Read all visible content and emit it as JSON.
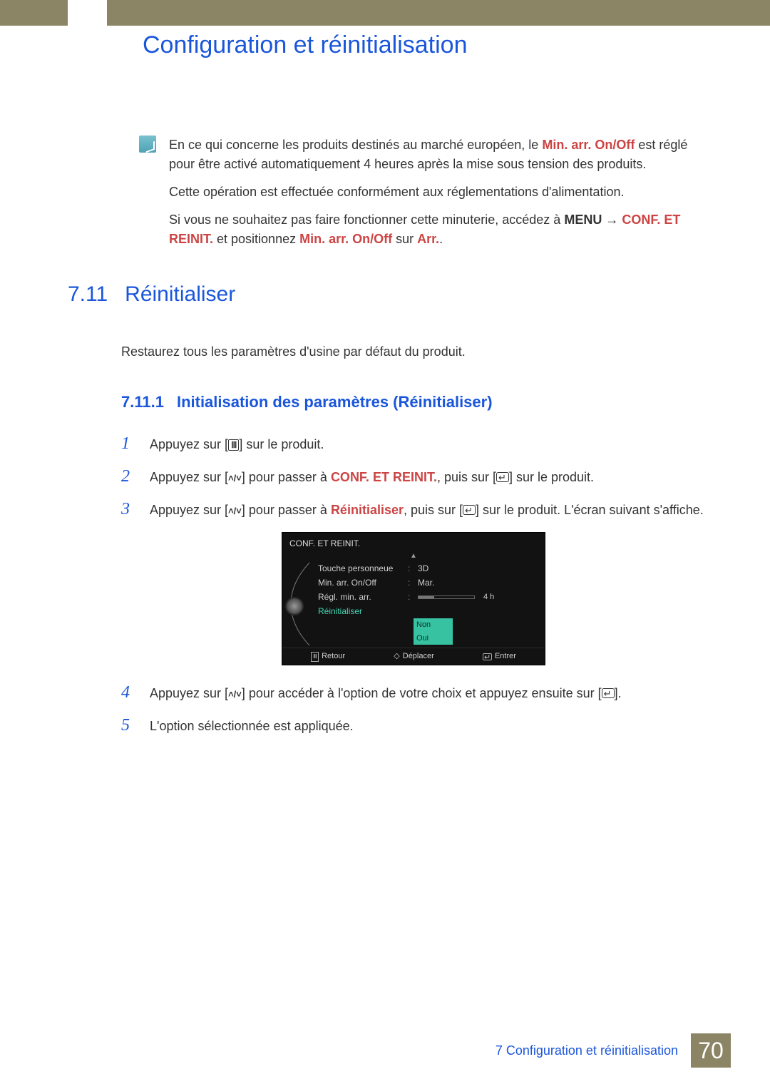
{
  "header": {
    "title": "Configuration et réinitialisation"
  },
  "note": {
    "p1a": "En ce qui concerne les produits destinés au marché européen, le ",
    "p1b": "Min. arr. On/Off",
    "p1c": " est réglé pour être activé automatiquement 4 heures après la mise sous tension des produits.",
    "p2": "Cette opération est effectuée conformément aux réglementations d'alimentation.",
    "p3a": "Si vous ne souhaitez pas faire fonctionner cette minuterie, accédez à ",
    "p3b": "MENU",
    "p3arrow": " → ",
    "p3c": "CONF. ET REINIT.",
    "p3d": " et positionnez ",
    "p3e": "Min. arr. On/Off",
    "p3f": " sur ",
    "p3g": "Arr.",
    "p3h": "."
  },
  "section": {
    "num": "7.11",
    "title": "Réinitialiser",
    "intro": "Restaurez tous les paramètres d'usine par défaut du produit.",
    "sub": {
      "num": "7.11.1",
      "title": "Initialisation des paramètres (Réinitialiser)"
    }
  },
  "steps": {
    "s1": {
      "n": "1",
      "a": "Appuyez sur [",
      "b": "] sur le produit."
    },
    "s2": {
      "n": "2",
      "a": "Appuyez sur [",
      "b": "] pour passer à ",
      "c": "CONF. ET REINIT.",
      "d": ", puis sur [",
      "e": "] sur le produit."
    },
    "s3": {
      "n": "3",
      "a": "Appuyez sur [",
      "b": "] pour passer à ",
      "c": "Réinitialiser",
      "d": ", puis sur [",
      "e": "] sur le produit. L'écran suivant s'affiche."
    },
    "s4": {
      "n": "4",
      "a": "Appuyez sur [",
      "b": "] pour accéder à l'option de votre choix et appuyez ensuite sur [",
      "c": "]."
    },
    "s5": {
      "n": "5",
      "a": "L'option sélectionnée est appliquée."
    }
  },
  "osd": {
    "title": "CONF. ET REINIT.",
    "rows": {
      "r1": {
        "label": "Touche personneue",
        "val": "3D"
      },
      "r2": {
        "label": "Min. arr. On/Off",
        "val": "Mar."
      },
      "r3": {
        "label": "Régl. min. arr.",
        "bar_text": "4 h"
      },
      "r4": {
        "label": "Réinitialiser"
      }
    },
    "options": {
      "o1": "Non",
      "o2": "Oui"
    },
    "footer": {
      "f1": "Retour",
      "f2": "Déplacer",
      "f3": "Entrer"
    }
  },
  "footer": {
    "chapter": "7 Configuration et réinitialisation",
    "page": "70"
  }
}
